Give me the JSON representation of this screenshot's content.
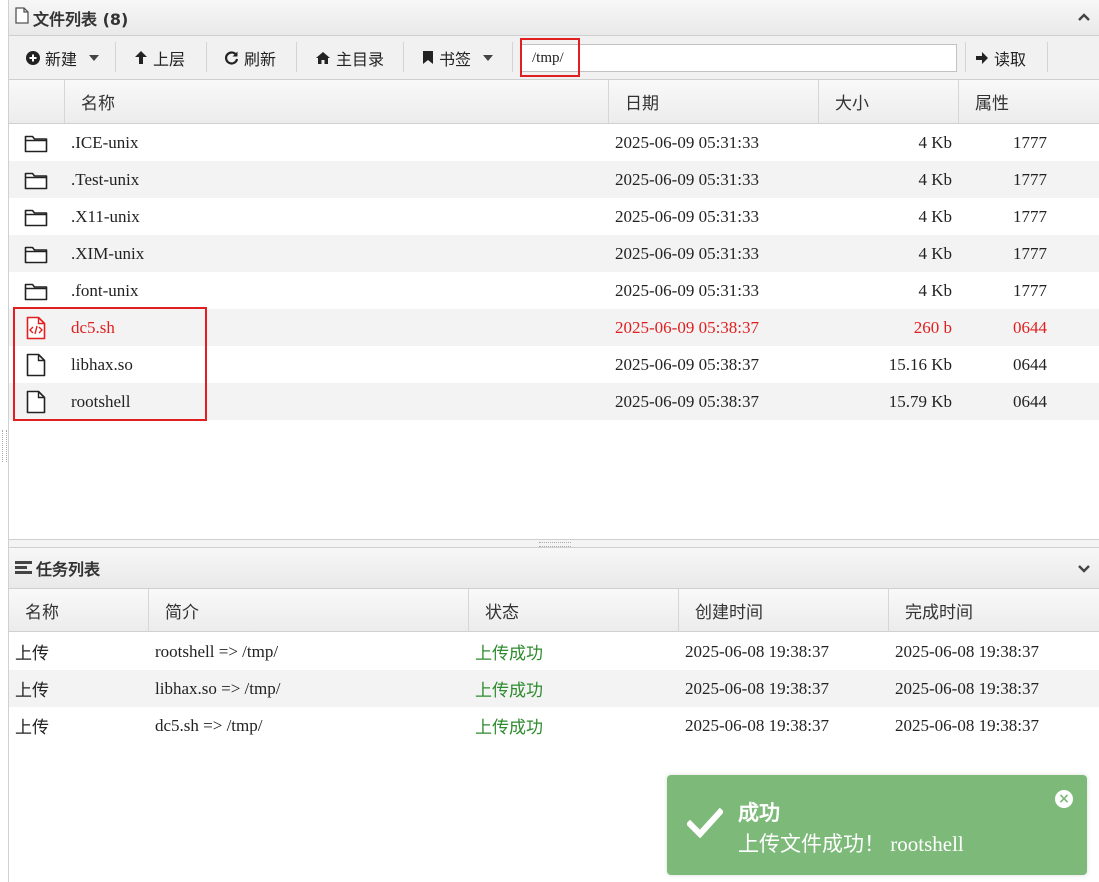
{
  "file_panel": {
    "title": "文件列表 (8)"
  },
  "toolbar": {
    "new_label": "新建",
    "up_label": "上层",
    "refresh_label": "刷新",
    "home_label": "主目录",
    "bookmark_label": "书签",
    "path_value": "/tmp/",
    "read_label": "读取"
  },
  "file_columns": {
    "name": "名称",
    "date": "日期",
    "size": "大小",
    "attr": "属性"
  },
  "files": [
    {
      "icon": "folder-icon",
      "name": ".ICE-unix",
      "date": "2025-06-09 05:31:33",
      "size": "4 Kb",
      "attr": "1777"
    },
    {
      "icon": "folder-icon",
      "name": ".Test-unix",
      "date": "2025-06-09 05:31:33",
      "size": "4 Kb",
      "attr": "1777"
    },
    {
      "icon": "folder-icon",
      "name": ".X11-unix",
      "date": "2025-06-09 05:31:33",
      "size": "4 Kb",
      "attr": "1777"
    },
    {
      "icon": "folder-icon",
      "name": ".XIM-unix",
      "date": "2025-06-09 05:31:33",
      "size": "4 Kb",
      "attr": "1777"
    },
    {
      "icon": "folder-icon",
      "name": ".font-unix",
      "date": "2025-06-09 05:31:33",
      "size": "4 Kb",
      "attr": "1777"
    },
    {
      "icon": "code-file-icon",
      "name": "dc5.sh",
      "date": "2025-06-09 05:38:37",
      "size": "260 b",
      "attr": "0644"
    },
    {
      "icon": "file-icon",
      "name": "libhax.so",
      "date": "2025-06-09 05:38:37",
      "size": "15.16 Kb",
      "attr": "0644"
    },
    {
      "icon": "file-icon",
      "name": "rootshell",
      "date": "2025-06-09 05:38:37",
      "size": "15.79 Kb",
      "attr": "0644"
    }
  ],
  "task_panel": {
    "title": "任务列表"
  },
  "task_columns": {
    "name": "名称",
    "desc": "简介",
    "status": "状态",
    "created": "创建时间",
    "finished": "完成时间"
  },
  "tasks": [
    {
      "name": "上传",
      "desc": "rootshell => /tmp/",
      "status": "上传成功",
      "created": "2025-06-08 19:38:37",
      "finished": "2025-06-08 19:38:37"
    },
    {
      "name": "上传",
      "desc": "libhax.so => /tmp/",
      "status": "上传成功",
      "created": "2025-06-08 19:38:37",
      "finished": "2025-06-08 19:38:37"
    },
    {
      "name": "上传",
      "desc": "dc5.sh => /tmp/",
      "status": "上传成功",
      "created": "2025-06-08 19:38:37",
      "finished": "2025-06-08 19:38:37"
    }
  ],
  "toast": {
    "title": "成功",
    "message": "上传文件成功！ rootshell",
    "close_symbol": "×"
  },
  "colors": {
    "highlight_red": "#e02020",
    "status_green": "#2e8b2e",
    "toast_bg": "#7dba7a"
  }
}
